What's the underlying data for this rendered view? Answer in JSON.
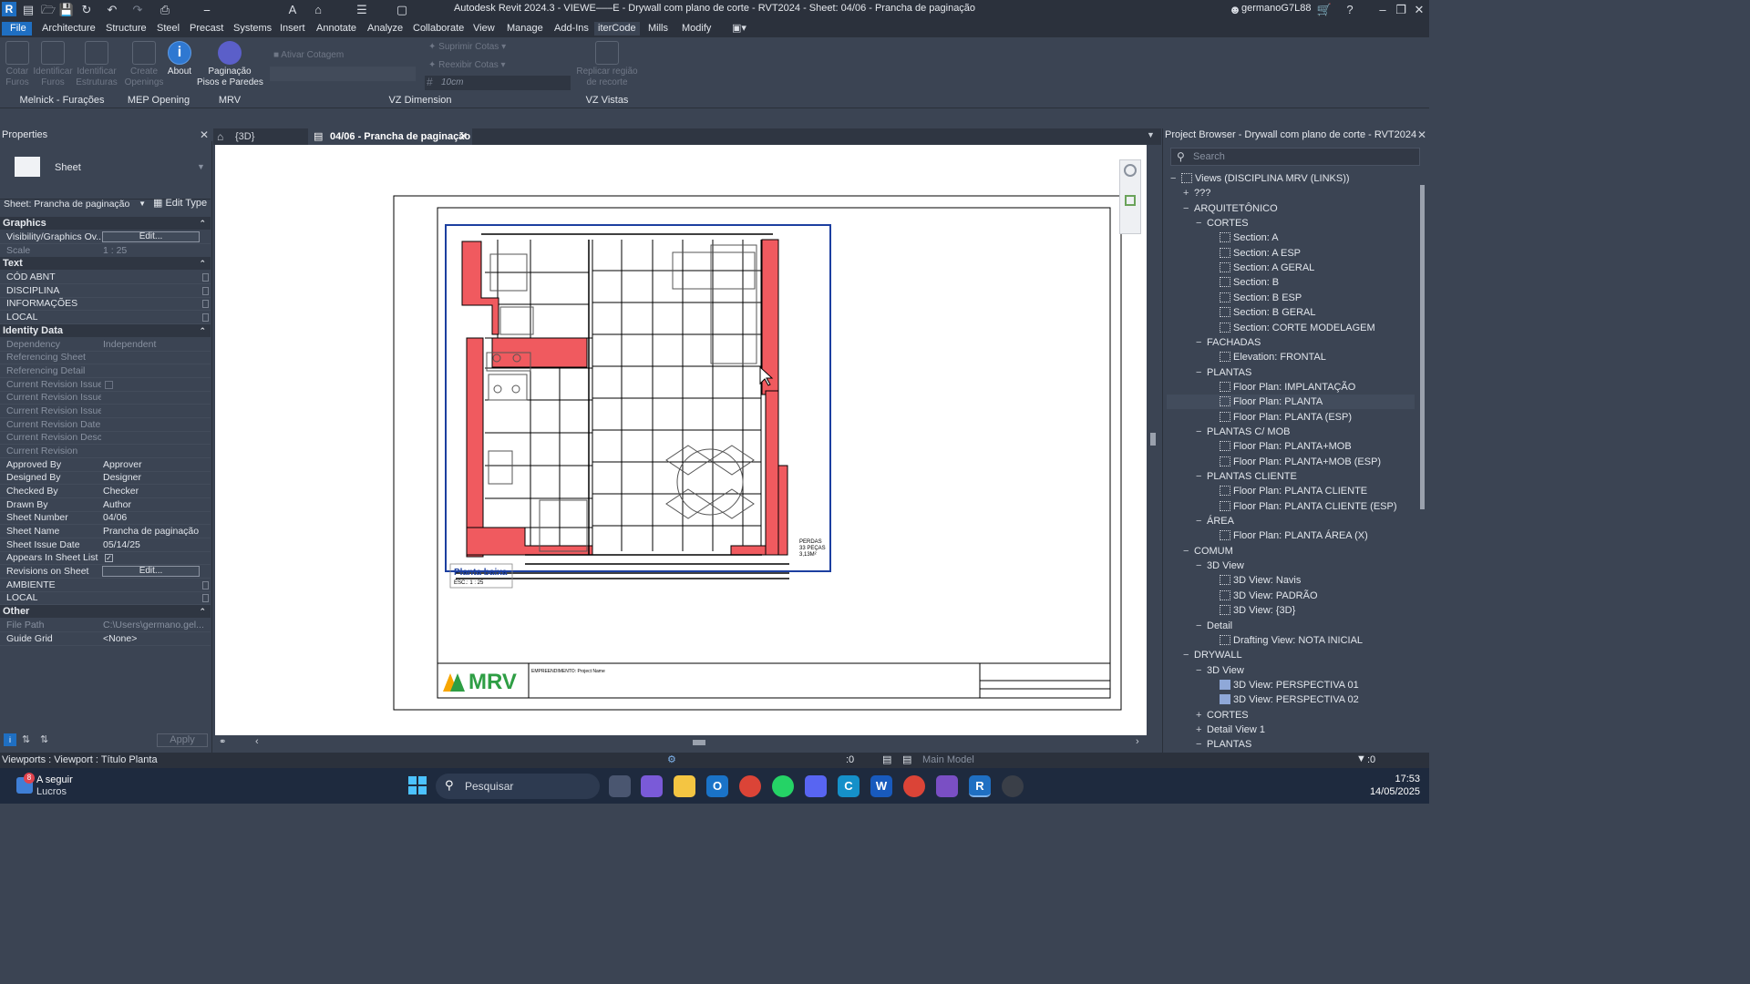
{
  "app": {
    "title": "Autodesk Revit 2024.3 - VIEWE–––E - Drywall com plano de corte - RVT2024 - Sheet: 04/06 - Prancha de paginação",
    "user": "germanoG7L88",
    "logo_letter": "R"
  },
  "menu": [
    "File",
    "Architecture",
    "Structure",
    "Steel",
    "Precast",
    "Systems",
    "Insert",
    "Annotate",
    "Analyze",
    "Collaborate",
    "View",
    "Manage",
    "Add-Ins",
    "iterCode",
    "Mills",
    "Modify"
  ],
  "ribbon": {
    "melnick": {
      "b1": "Cotar\nFuros",
      "b2": "Identificar\nFuros",
      "b3": "Identificar\nEstruturas",
      "panel": "Melnick - Furações"
    },
    "mep": {
      "b1": "Create\nOpenings",
      "b2": "About",
      "panel": "MEP Opening"
    },
    "mrv": {
      "b1": "Paginação\nPisos e Paredes",
      "panel": "MRV"
    },
    "vzdim": {
      "a": "Ativar Cotagem",
      "b": "Suprimir Cotas",
      "c": "Reexibir Cotas",
      "d": "10cm",
      "panel": "VZ Dimension"
    },
    "vzvistas": {
      "b1": "Replicar região\nde recorte",
      "panel": "VZ Vistas"
    }
  },
  "properties": {
    "title": "Properties",
    "type": "Sheet",
    "selector": "Sheet: Prancha de paginação",
    "edit_type": "Edit Type",
    "sections": {
      "graphics": "Graphics",
      "text": "Text",
      "identity": "Identity Data",
      "other": "Other"
    },
    "rows": {
      "vis_k": "Visibility/Graphics Ov...",
      "vis_v": "Edit...",
      "scale_k": "Scale",
      "scale_v": "1 : 25",
      "cod": "CÓD ABNT",
      "disc": "DISCIPLINA",
      "info": "INFORMAÇÕES",
      "local1": "LOCAL",
      "dep_k": "Dependency",
      "dep_v": "Independent",
      "refs": "Referencing Sheet",
      "refd": "Referencing Detail",
      "cri": "Current Revision Issued",
      "crib": "Current Revision Issue...",
      "crit": "Current Revision Issue...",
      "crd": "Current Revision Date",
      "crdesc": "Current Revision Desc...",
      "cr": "Current Revision",
      "appr_k": "Approved By",
      "appr_v": "Approver",
      "des_k": "Designed By",
      "des_v": "Designer",
      "chk_k": "Checked By",
      "chk_v": "Checker",
      "drw_k": "Drawn By",
      "drw_v": "Author",
      "num_k": "Sheet Number",
      "num_v": "04/06",
      "name_k": "Sheet Name",
      "name_v": "Prancha de paginação",
      "date_k": "Sheet Issue Date",
      "date_v": "05/14/25",
      "list_k": "Appears In Sheet List",
      "revs_k": "Revisions on Sheet",
      "revs_v": "Edit...",
      "amb": "AMBIENTE",
      "local2": "LOCAL",
      "path_k": "File Path",
      "path_v": "C:\\Users\\germano.gel...",
      "grid_k": "Guide Grid",
      "grid_v": "<None>"
    },
    "apply": "Apply"
  },
  "tabs": {
    "t1": "{3D}",
    "t2": "04/06 - Prancha de paginação"
  },
  "sheet": {
    "viewport_title": "Planta baixa",
    "viewport_scale": "ESC.: 1 : 25",
    "perdas": "PERDAS",
    "pecas": "33 PEÇAS",
    "area": "3,13M²",
    "brand": "MRV",
    "empreendimento": "EMPREENDIMENTO: Project Name"
  },
  "browser": {
    "title": "Project Browser - Drywall com plano de corte - RVT2024",
    "search_placeholder": "Search",
    "nodes": [
      {
        "pm": "−",
        "icon": "views",
        "label": "Views (DISCIPLINA MRV (LINKS))",
        "depth": 0
      },
      {
        "pm": "+",
        "icon": "",
        "label": "???",
        "depth": 1
      },
      {
        "pm": "−",
        "icon": "",
        "label": "ARQUITETÔNICO",
        "depth": 1
      },
      {
        "pm": "−",
        "icon": "",
        "label": "CORTES",
        "depth": 2
      },
      {
        "pm": "",
        "icon": "view",
        "label": "Section: A",
        "depth": 3
      },
      {
        "pm": "",
        "icon": "view",
        "label": "Section: A ESP",
        "depth": 3
      },
      {
        "pm": "",
        "icon": "view",
        "label": "Section: A GERAL",
        "depth": 3
      },
      {
        "pm": "",
        "icon": "view",
        "label": "Section: B",
        "depth": 3
      },
      {
        "pm": "",
        "icon": "view",
        "label": "Section: B ESP",
        "depth": 3
      },
      {
        "pm": "",
        "icon": "view",
        "label": "Section: B GERAL",
        "depth": 3
      },
      {
        "pm": "",
        "icon": "view",
        "label": "Section: CORTE MODELAGEM",
        "depth": 3
      },
      {
        "pm": "−",
        "icon": "",
        "label": "FACHADAS",
        "depth": 2
      },
      {
        "pm": "",
        "icon": "view",
        "label": "Elevation: FRONTAL",
        "depth": 3
      },
      {
        "pm": "−",
        "icon": "",
        "label": "PLANTAS",
        "depth": 2
      },
      {
        "pm": "",
        "icon": "view",
        "label": "Floor Plan: IMPLANTAÇÃO",
        "depth": 3
      },
      {
        "pm": "",
        "icon": "view",
        "label": "Floor Plan: PLANTA",
        "depth": 3,
        "hl": true
      },
      {
        "pm": "",
        "icon": "view",
        "label": "Floor Plan: PLANTA (ESP)",
        "depth": 3
      },
      {
        "pm": "−",
        "icon": "",
        "label": "PLANTAS C/ MOB",
        "depth": 2
      },
      {
        "pm": "",
        "icon": "view",
        "label": "Floor Plan: PLANTA+MOB",
        "depth": 3
      },
      {
        "pm": "",
        "icon": "view",
        "label": "Floor Plan: PLANTA+MOB (ESP)",
        "depth": 3
      },
      {
        "pm": "−",
        "icon": "",
        "label": "PLANTAS CLIENTE",
        "depth": 2
      },
      {
        "pm": "",
        "icon": "view",
        "label": "Floor Plan: PLANTA CLIENTE",
        "depth": 3
      },
      {
        "pm": "",
        "icon": "view",
        "label": "Floor Plan: PLANTA CLIENTE (ESP)",
        "depth": 3
      },
      {
        "pm": "−",
        "icon": "",
        "label": "ÁREA",
        "depth": 2
      },
      {
        "pm": "",
        "icon": "view",
        "label": "Floor Plan: PLANTA ÁREA (X)",
        "depth": 3
      },
      {
        "pm": "−",
        "icon": "",
        "label": "COMUM",
        "depth": 1
      },
      {
        "pm": "−",
        "icon": "",
        "label": "3D View",
        "depth": 2
      },
      {
        "pm": "",
        "icon": "view",
        "label": "3D View: Navis",
        "depth": 3
      },
      {
        "pm": "",
        "icon": "view",
        "label": "3D View: PADRÃO",
        "depth": 3
      },
      {
        "pm": "",
        "icon": "view",
        "label": "3D View: {3D}",
        "depth": 3
      },
      {
        "pm": "−",
        "icon": "",
        "label": "Detail",
        "depth": 2
      },
      {
        "pm": "",
        "icon": "view",
        "label": "Drafting View: NOTA INICIAL",
        "depth": 3
      },
      {
        "pm": "−",
        "icon": "",
        "label": "DRYWALL",
        "depth": 1
      },
      {
        "pm": "−",
        "icon": "",
        "label": "3D View",
        "depth": 2
      },
      {
        "pm": "",
        "icon": "view-sel",
        "label": "3D View: PERSPECTIVA 01",
        "depth": 3
      },
      {
        "pm": "",
        "icon": "view-sel",
        "label": "3D View: PERSPECTIVA 02",
        "depth": 3
      },
      {
        "pm": "+",
        "icon": "",
        "label": "CORTES",
        "depth": 2
      },
      {
        "pm": "+",
        "icon": "",
        "label": "Detail View 1",
        "depth": 2
      },
      {
        "pm": "−",
        "icon": "",
        "label": "PLANTAS",
        "depth": 2
      }
    ]
  },
  "status": {
    "left": "Viewports : Viewport : Título Planta",
    "count": ":0",
    "model": "Main Model",
    "filter": ":0"
  },
  "taskbar": {
    "weather_line1": "A seguir",
    "weather_line2": "Lucros",
    "badge": "8",
    "search": "Pesquisar",
    "time": "17:53",
    "date": "14/05/2025"
  },
  "colors": {
    "accent": "#1f6fc2",
    "wall_red": "#f05a5f",
    "viewport_blue": "#1c3fa0"
  }
}
